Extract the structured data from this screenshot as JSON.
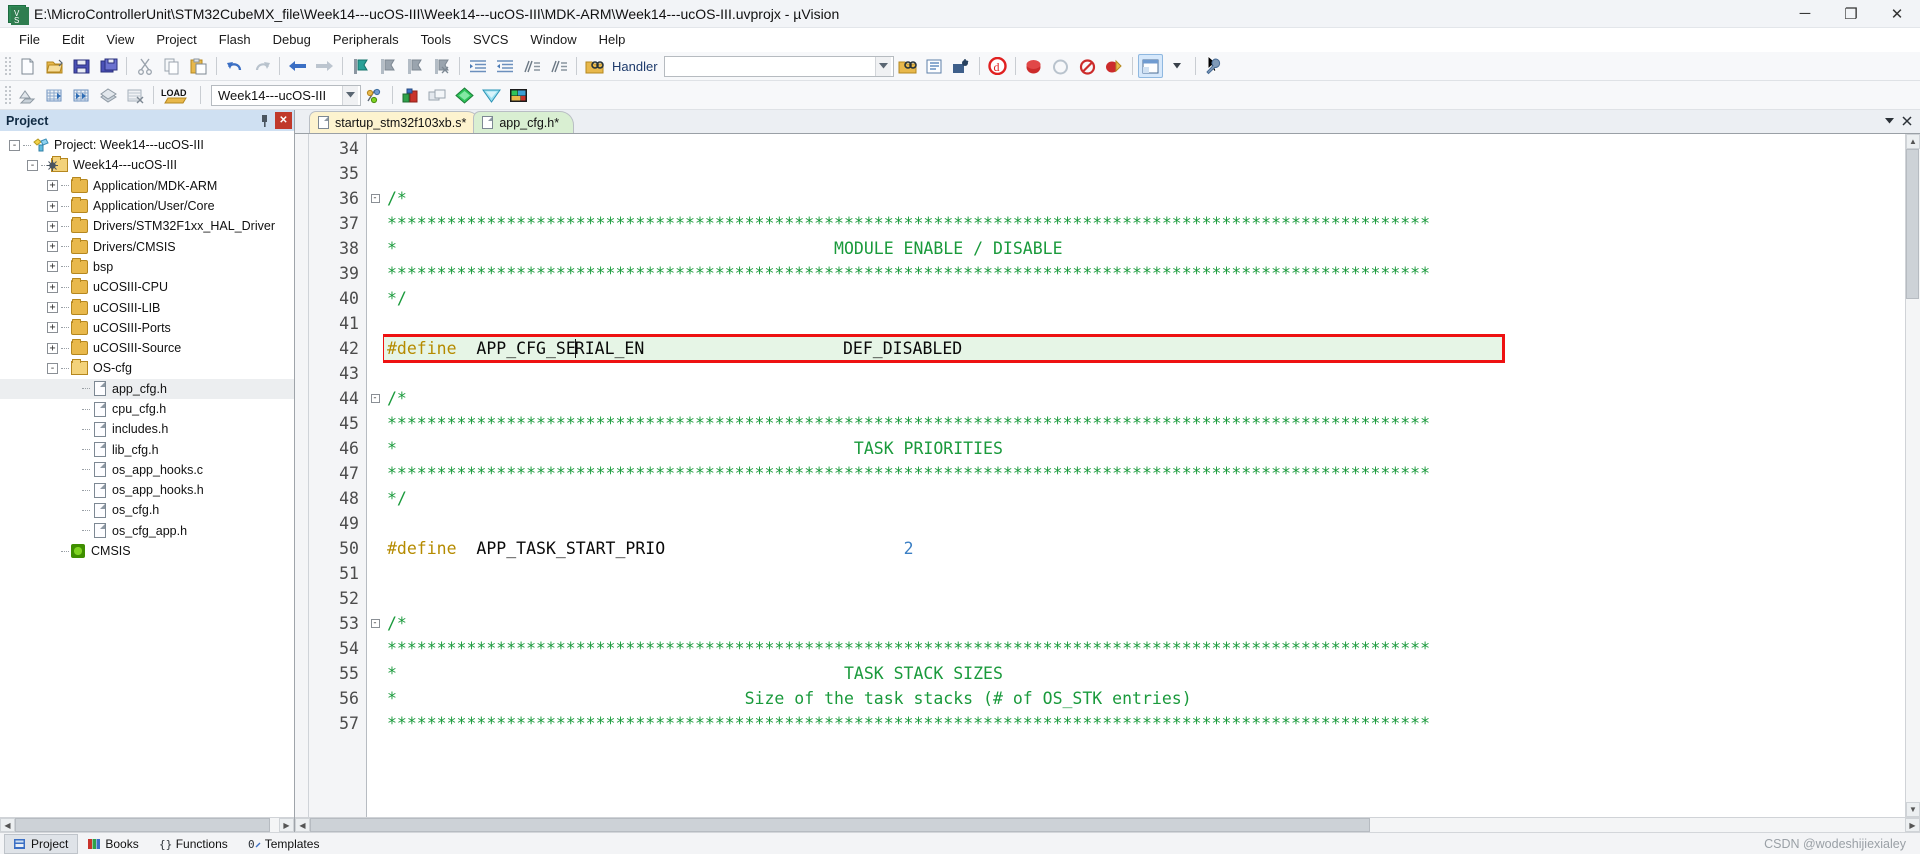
{
  "window": {
    "title": "E:\\MicroControllerUnit\\STM32CubeMX_file\\Week14---ucOS-III\\Week14---ucOS-III\\MDK-ARM\\Week14---ucOS-III.uvprojx - µVision",
    "logo_text": "V",
    "minimize": "─",
    "maximize": "❐",
    "close": "✕"
  },
  "menubar": {
    "items": [
      "File",
      "Edit",
      "View",
      "Project",
      "Flash",
      "Debug",
      "Peripherals",
      "Tools",
      "SVCS",
      "Window",
      "Help"
    ]
  },
  "toolbar1": {
    "icons": [
      "new-file-icon",
      "open-file-icon",
      "save-icon",
      "save-all-icon",
      "cut-icon",
      "copy-icon",
      "paste-icon",
      "undo-icon",
      "redo-icon",
      "navigate-back-icon",
      "navigate-forward-icon",
      "bookmark-toggle-icon",
      "bookmark-prev-icon",
      "bookmark-next-icon",
      "bookmark-clear-icon",
      "indent-icon",
      "outdent-icon",
      "comment-icon",
      "uncomment-icon",
      "find-in-files-icon"
    ],
    "handler_label": "Handler",
    "right_icons": [
      "insert-bookmark-icon",
      "configure-icon",
      "debug-settings-icon",
      "start-debug-icon",
      "stop-icon",
      "reset-icon",
      "disable-breakpoints-icon",
      "kill-breakpoints-icon",
      "window-layout-icon",
      "settings-wrench-icon"
    ]
  },
  "toolbar2": {
    "icons": [
      "translate-icon",
      "build-icon",
      "rebuild-icon",
      "batch-build-icon",
      "stop-build-icon",
      "load-icon"
    ],
    "load_label": "LOAD",
    "project_target": "Week14---ucOS-III",
    "right_icons": [
      "target-options-icon",
      "manage-components-icon",
      "pack-installer-icon",
      "select-software-packs-icon",
      "manage-runtime-env-icon"
    ]
  },
  "project_panel": {
    "title": "Project",
    "pin_icon": "pin-icon",
    "close_icon": "close-icon",
    "tree": [
      {
        "label": "Project: Week14---ucOS-III",
        "indent": 0,
        "expander": "-",
        "icon": "project-icon"
      },
      {
        "label": "Week14---ucOS-III",
        "indent": 1,
        "expander": "-",
        "icon": "target-folder-icon"
      },
      {
        "label": "Application/MDK-ARM",
        "indent": 2,
        "expander": "+",
        "icon": "folder-icon"
      },
      {
        "label": "Application/User/Core",
        "indent": 2,
        "expander": "+",
        "icon": "folder-icon"
      },
      {
        "label": "Drivers/STM32F1xx_HAL_Driver",
        "indent": 2,
        "expander": "+",
        "icon": "folder-icon"
      },
      {
        "label": "Drivers/CMSIS",
        "indent": 2,
        "expander": "+",
        "icon": "folder-icon"
      },
      {
        "label": "bsp",
        "indent": 2,
        "expander": "+",
        "icon": "folder-icon"
      },
      {
        "label": "uCOSIII-CPU",
        "indent": 2,
        "expander": "+",
        "icon": "folder-icon"
      },
      {
        "label": "uCOSIII-LIB",
        "indent": 2,
        "expander": "+",
        "icon": "folder-icon"
      },
      {
        "label": "uCOSIII-Ports",
        "indent": 2,
        "expander": "+",
        "icon": "folder-icon"
      },
      {
        "label": "uCOSIII-Source",
        "indent": 2,
        "expander": "+",
        "icon": "folder-icon"
      },
      {
        "label": "OS-cfg",
        "indent": 2,
        "expander": "-",
        "icon": "folder-open-icon"
      },
      {
        "label": "app_cfg.h",
        "indent": 3,
        "expander": "",
        "icon": "file-icon",
        "selected": true
      },
      {
        "label": "cpu_cfg.h",
        "indent": 3,
        "expander": "",
        "icon": "file-icon"
      },
      {
        "label": "includes.h",
        "indent": 3,
        "expander": "",
        "icon": "file-icon"
      },
      {
        "label": "lib_cfg.h",
        "indent": 3,
        "expander": "",
        "icon": "file-icon"
      },
      {
        "label": "os_app_hooks.c",
        "indent": 3,
        "expander": "",
        "icon": "file-icon"
      },
      {
        "label": "os_app_hooks.h",
        "indent": 3,
        "expander": "",
        "icon": "file-icon"
      },
      {
        "label": "os_cfg.h",
        "indent": 3,
        "expander": "",
        "icon": "file-icon"
      },
      {
        "label": "os_cfg_app.h",
        "indent": 3,
        "expander": "",
        "icon": "file-icon"
      },
      {
        "label": "CMSIS",
        "indent": 2,
        "expander": "",
        "icon": "cmsis-icon"
      }
    ]
  },
  "editor": {
    "tabs": [
      {
        "label": "startup_stm32f103xb.s*",
        "active": false,
        "color": "yellow"
      },
      {
        "label": "app_cfg.h*",
        "active": true,
        "color": "green"
      }
    ],
    "tab_controls": [
      "chevron-down-icon",
      "close-icon"
    ],
    "first_line_number": 34,
    "lines": [
      {
        "n": 34,
        "fold": "",
        "segs": []
      },
      {
        "n": 35,
        "fold": "",
        "segs": []
      },
      {
        "n": 36,
        "fold": "-",
        "segs": [
          {
            "t": "/*",
            "c": "cmt"
          }
        ]
      },
      {
        "n": 37,
        "fold": "",
        "segs": [
          {
            "t": "*********************************************************************************************************",
            "c": "cmt"
          }
        ]
      },
      {
        "n": 38,
        "fold": "",
        "segs": [
          {
            "t": "*                                            MODULE ENABLE / DISABLE",
            "c": "cmt"
          }
        ]
      },
      {
        "n": 39,
        "fold": "",
        "segs": [
          {
            "t": "*********************************************************************************************************",
            "c": "cmt"
          }
        ]
      },
      {
        "n": 40,
        "fold": "",
        "segs": [
          {
            "t": "*/",
            "c": "cmt"
          }
        ]
      },
      {
        "n": 41,
        "fold": "",
        "segs": []
      },
      {
        "n": 42,
        "fold": "",
        "highlight": true,
        "segs": [
          {
            "t": "#define",
            "c": "pre"
          },
          {
            "t": "  APP_CFG_SE",
            "c": "plain"
          },
          {
            "t": "|caret|",
            "c": "caret"
          },
          {
            "t": "RIAL_EN",
            "c": "plain"
          },
          {
            "t": "                    DEF_DISABLED",
            "c": "plain"
          }
        ]
      },
      {
        "n": 43,
        "fold": "",
        "segs": []
      },
      {
        "n": 44,
        "fold": "-",
        "segs": [
          {
            "t": "/*",
            "c": "cmt"
          }
        ]
      },
      {
        "n": 45,
        "fold": "",
        "segs": [
          {
            "t": "*********************************************************************************************************",
            "c": "cmt"
          }
        ]
      },
      {
        "n": 46,
        "fold": "",
        "segs": [
          {
            "t": "*                                              TASK PRIORITIES",
            "c": "cmt"
          }
        ]
      },
      {
        "n": 47,
        "fold": "",
        "segs": [
          {
            "t": "*********************************************************************************************************",
            "c": "cmt"
          }
        ]
      },
      {
        "n": 48,
        "fold": "",
        "segs": [
          {
            "t": "*/",
            "c": "cmt"
          }
        ]
      },
      {
        "n": 49,
        "fold": "",
        "segs": []
      },
      {
        "n": 50,
        "fold": "",
        "segs": [
          {
            "t": "#define",
            "c": "pre"
          },
          {
            "t": "  APP_TASK_START_PRIO                        ",
            "c": "plain"
          },
          {
            "t": "2",
            "c": "num"
          }
        ]
      },
      {
        "n": 51,
        "fold": "",
        "segs": []
      },
      {
        "n": 52,
        "fold": "",
        "segs": []
      },
      {
        "n": 53,
        "fold": "-",
        "segs": [
          {
            "t": "/*",
            "c": "cmt"
          }
        ]
      },
      {
        "n": 54,
        "fold": "",
        "segs": [
          {
            "t": "*********************************************************************************************************",
            "c": "cmt"
          }
        ]
      },
      {
        "n": 55,
        "fold": "",
        "segs": [
          {
            "t": "*                                             TASK STACK SIZES",
            "c": "cmt"
          }
        ]
      },
      {
        "n": 56,
        "fold": "",
        "segs": [
          {
            "t": "*                                   Size of the task stacks (# of OS_STK entries)",
            "c": "cmt"
          }
        ]
      },
      {
        "n": 57,
        "fold": "",
        "segs": [
          {
            "t": "*********************************************************************************************************",
            "c": "cmt"
          }
        ]
      }
    ]
  },
  "statusbar": {
    "tabs": [
      {
        "label": "Project",
        "icon": "project-icon",
        "active": true
      },
      {
        "label": "Books",
        "icon": "books-icon",
        "active": false
      },
      {
        "label": "Functions",
        "icon": "functions-icon",
        "active": false
      },
      {
        "label": "Templates",
        "icon": "templates-icon",
        "active": false
      }
    ],
    "watermark": "CSDN @wodeshijiexialey"
  },
  "colors": {
    "title_bg": "#f2f4f7",
    "panel_header": "#cfe0f2",
    "comment_green": "#1a9a3c",
    "preproc_gold": "#b58b00",
    "number_blue": "#3b7fc4",
    "highlight_bg": "#e6f5e6",
    "highlight_border": "#ee1111",
    "tab_yellow": "#fdf3cf",
    "tab_green": "#d9efd2"
  }
}
